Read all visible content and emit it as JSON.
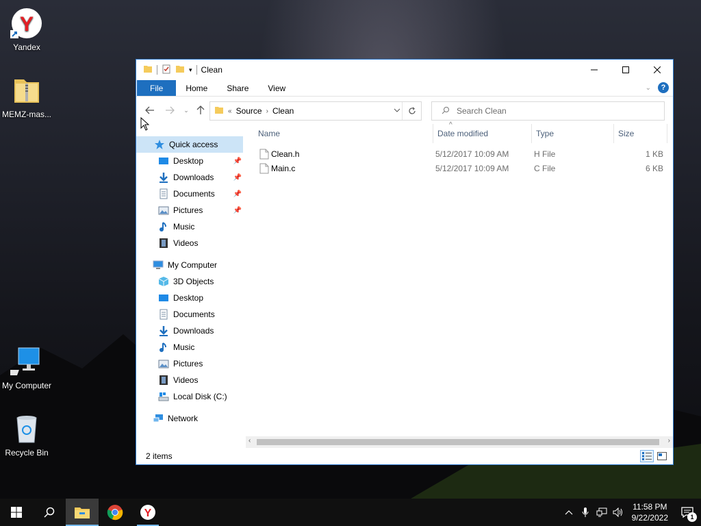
{
  "desktop": {
    "icons": [
      {
        "label": "Yandex"
      },
      {
        "label": "MEMZ-mas..."
      },
      {
        "label": "My Computer"
      },
      {
        "label": "Recycle Bin"
      }
    ]
  },
  "window": {
    "title": "Clean",
    "ribbon_tabs": [
      "File",
      "Home",
      "Share",
      "View"
    ],
    "help_label": "?",
    "address": {
      "overflow": "«",
      "crumbs": [
        "Source",
        "Clean"
      ]
    },
    "search": {
      "placeholder": "Search Clean"
    },
    "nav": {
      "quick_access": "Quick access",
      "quick_items": [
        {
          "label": "Desktop",
          "pinned": true
        },
        {
          "label": "Downloads",
          "pinned": true
        },
        {
          "label": "Documents",
          "pinned": true
        },
        {
          "label": "Pictures",
          "pinned": true
        },
        {
          "label": "Music",
          "pinned": false
        },
        {
          "label": "Videos",
          "pinned": false
        }
      ],
      "computer": "My Computer",
      "computer_items": [
        {
          "label": "3D Objects"
        },
        {
          "label": "Desktop"
        },
        {
          "label": "Documents"
        },
        {
          "label": "Downloads"
        },
        {
          "label": "Music"
        },
        {
          "label": "Pictures"
        },
        {
          "label": "Videos"
        },
        {
          "label": "Local Disk (C:)"
        }
      ],
      "network": "Network"
    },
    "columns": [
      "Name",
      "Date modified",
      "Type",
      "Size"
    ],
    "files": [
      {
        "name": "Clean.h",
        "date": "5/12/2017 10:09 AM",
        "type": "H File",
        "size": "1 KB"
      },
      {
        "name": "Main.c",
        "date": "5/12/2017 10:09 AM",
        "type": "C File",
        "size": "6 KB"
      }
    ],
    "status": "2 items"
  },
  "taskbar": {
    "time": "11:58 PM",
    "date": "9/22/2022",
    "notification_count": "1"
  },
  "colors": {
    "accent": "#1e6fbf",
    "selection": "#cce4f7",
    "taskbar": "#101010"
  }
}
